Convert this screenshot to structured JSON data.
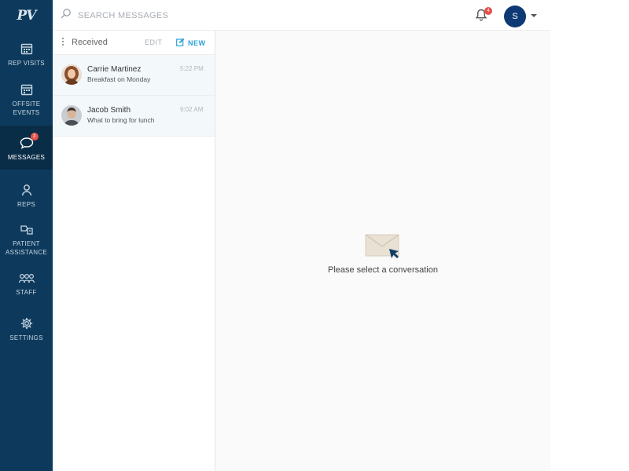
{
  "brand": {
    "logo_text": "PV"
  },
  "sidebar": {
    "items": [
      {
        "label": "REP VISITS",
        "icon": "calendar-icon"
      },
      {
        "label": "OFFSITE\nEVENTS",
        "icon": "calendar-icon"
      },
      {
        "label": "MESSAGES",
        "icon": "chat-bubble-icon",
        "badge": "3",
        "active": true
      },
      {
        "label": "REPS",
        "icon": "person-icon"
      },
      {
        "label": "PATIENT\nASSISTANCE",
        "icon": "assistance-icon"
      },
      {
        "label": "STAFF",
        "icon": "group-icon"
      },
      {
        "label": "SETTINGS",
        "icon": "gear-icon"
      }
    ]
  },
  "topbar": {
    "search_placeholder": "SEARCH MESSAGES",
    "notifications_badge": "4",
    "user_initial": "S"
  },
  "message_list": {
    "filter_label": "Received",
    "edit_label": "EDIT",
    "new_label": "NEW",
    "conversations": [
      {
        "name": "Carrie Martinez",
        "preview": "Breakfast on Monday",
        "time": "5:22 PM"
      },
      {
        "name": "Jacob Smith",
        "preview": "What to bring for lunch",
        "time": "9:02 AM"
      }
    ]
  },
  "empty_state": {
    "text": "Please select a conversation"
  },
  "colors": {
    "sidebar_bg": "#0d3a5c",
    "accent": "#2fa0d8",
    "badge": "#e4524a",
    "avatar_bg": "#0d3a75"
  }
}
